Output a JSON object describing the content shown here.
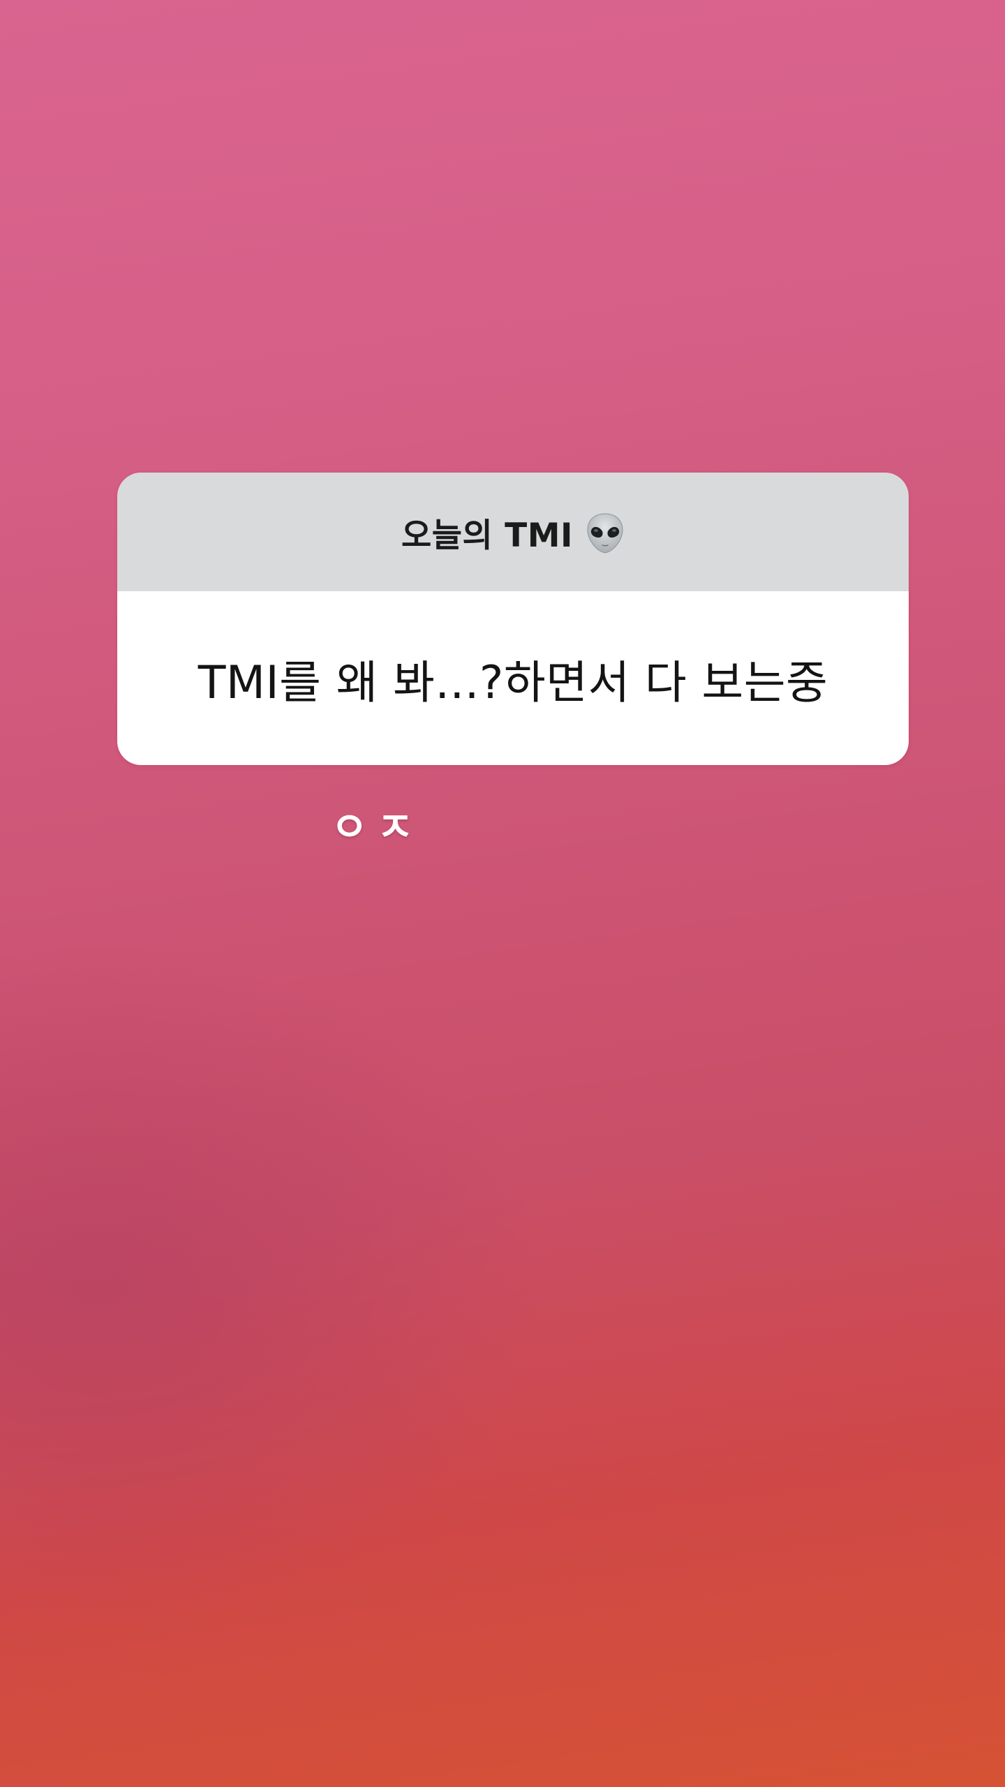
{
  "question_sticker": {
    "title": "오늘의 TMI",
    "title_icon": "alien-emoji-icon",
    "answer_text": "TMI를 왜 봐...?하면서 다 보는중"
  },
  "reply": {
    "text": "ㅇㅈ"
  },
  "colors": {
    "background_top": "#d9648f",
    "background_bottom": "#d65234",
    "card_header": "#d9dadb",
    "card_body": "#ffffff",
    "reply_text": "#ffffff"
  }
}
